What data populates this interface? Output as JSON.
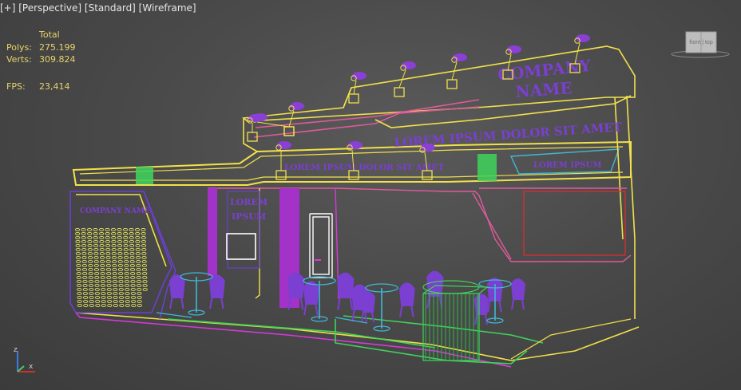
{
  "viewport": {
    "label": "[+] [Perspective] [Standard] [Wireframe]",
    "items": [
      "[+]",
      "[Perspective]",
      "[Standard]",
      "[Wireframe]"
    ]
  },
  "stats": {
    "header": "Total",
    "polys_label": "Polys:",
    "polys_value": "275.199",
    "verts_label": "Verts:",
    "verts_value": "309.824",
    "fps_label": "FPS:",
    "fps_value": "23,414"
  },
  "scene_text": {
    "company_top_1": "COMPANY",
    "company_top_2": "NAME",
    "lorem_main": "LOREM IPSUM DOLOR SIT AMET",
    "lorem_mid": "LOREM IPSUM DOLOR SIT AMET",
    "lorem_right": "LOREM IPSUM",
    "company_left": "COMPANY NAME",
    "lorem_pillar_1": "LOREM",
    "lorem_pillar_2": "IPSUM"
  },
  "viewcube": {
    "label": "front | top"
  },
  "axis": {
    "z": "z",
    "x": "x"
  },
  "colors": {
    "yellow": "#f2e14a",
    "purple": "#8a3fd6",
    "magenta": "#d43ad8",
    "cyan": "#3fb8d8",
    "green": "#3fd45a",
    "pink": "#e05a9a",
    "red": "#d03030",
    "stat_text": "#e8d36a"
  }
}
